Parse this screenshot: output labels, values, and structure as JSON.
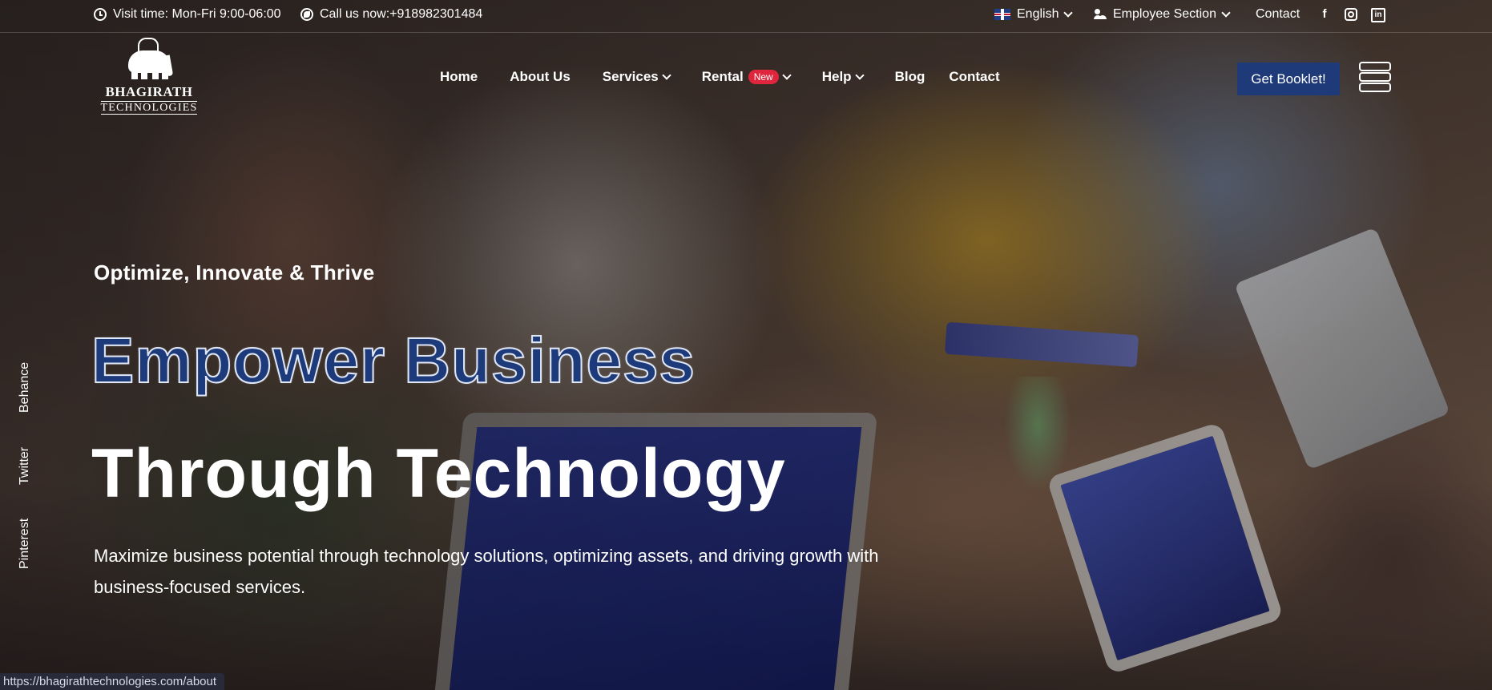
{
  "topbar": {
    "visit_time": "Visit time: Mon-Fri 9:00-06:00",
    "call": "Call us now:+918982301484",
    "language": "English",
    "employee_section": "Employee Section",
    "contact": "Contact",
    "facebook": "f",
    "linkedin": "in"
  },
  "logo": {
    "line1": "BHAGIRATH",
    "line2": "TECHNOLOGIES"
  },
  "nav": {
    "home": "Home",
    "about": "About Us",
    "services": "Services",
    "rental": "Rental",
    "rental_badge": "New",
    "help": "Help",
    "blog": "Blog",
    "contact": "Contact"
  },
  "cta": {
    "label": "Get Booklet!"
  },
  "side_social": {
    "behance": "Behance",
    "twitter": "Twitter",
    "pinterest": "Pinterest"
  },
  "hero": {
    "tagline": "Optimize, Innovate & Thrive",
    "headline_line1": "Empower Business",
    "headline_line2": "Through Technology",
    "description": "Maximize business potential through technology solutions, optimizing assets, and driving growth with business-focused services."
  },
  "status_bar": {
    "url": "https://bhagirathtechnologies.com/about"
  },
  "colors": {
    "brand_blue": "#1f3a78",
    "badge_red": "#e0263c",
    "headline_blue": "#1d3a7a"
  }
}
